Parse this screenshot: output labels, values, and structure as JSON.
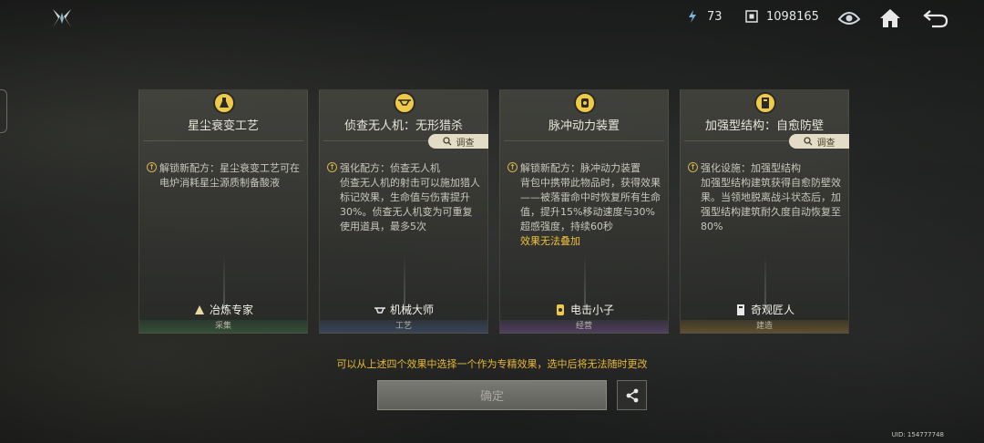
{
  "topbar": {
    "energy_value": "73",
    "coins_value": "1098165"
  },
  "cards": [
    {
      "title": "星尘衰变工艺",
      "has_investigate": false,
      "body": "解锁新配方：星尘衰变工艺可在电炉消耗星尘源质制备酸液",
      "note": "",
      "profession": "冶炼专家",
      "category": "采集"
    },
    {
      "title": "侦查无人机：无形猎杀",
      "has_investigate": true,
      "body": "强化配方：侦查无人机\n侦查无人机的射击可以施加猎人标记效果，生命值与伤害提升30%。侦查无人机变为可重复使用道具，最多5次",
      "note": "",
      "profession": "机械大师",
      "category": "工艺"
    },
    {
      "title": "脉冲动力装置",
      "has_investigate": false,
      "body": "解锁新配方：脉冲动力装置\n背包中携带此物品时，获得效果——被落雷命中时恢复所有生命值，提升15%移动速度与30%超感强度，持续60秒",
      "note": "效果无法叠加",
      "profession": "电击小子",
      "category": "经营"
    },
    {
      "title": "加强型结构：自愈防壁",
      "has_investigate": true,
      "body": "强化设施：加强型结构\n加强型结构建筑获得自愈防壁效果。当领地脱离战斗状态后，加强型结构建筑耐久度自动恢复至80%",
      "note": "",
      "profession": "奇观匠人",
      "category": "建造"
    }
  ],
  "investigate_label": "调查",
  "hint": "可以从上述四个效果中选择一个作为专精效果，选中后将无法随时更改",
  "confirm_label": "确定",
  "uid": "UID: 154777748",
  "colors": {
    "accent_gold": "#e6b83a",
    "icon_gold": "#efc94a"
  },
  "icons": [
    "logo-icon",
    "energy-icon",
    "coin-icon",
    "mode-icon",
    "home-icon",
    "back-icon",
    "search-icon",
    "share-icon"
  ]
}
